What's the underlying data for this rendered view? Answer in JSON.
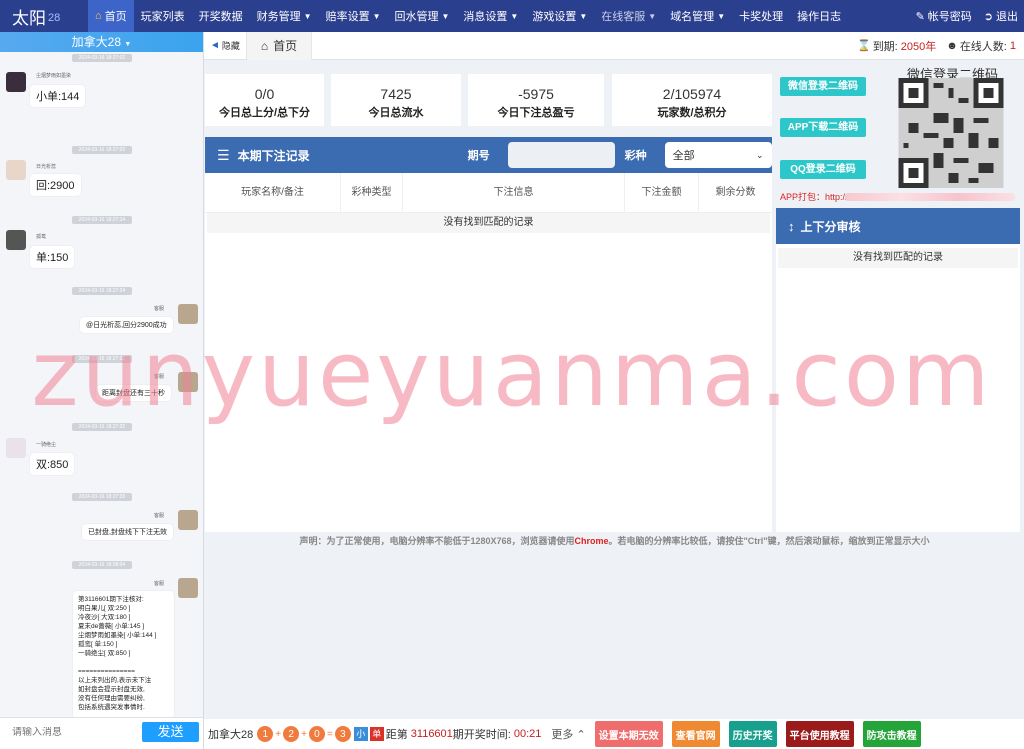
{
  "brand": {
    "name": "太阳",
    "num": "28"
  },
  "nav": {
    "items": [
      {
        "label": "首页",
        "active": true
      },
      {
        "label": "玩家列表"
      },
      {
        "label": "开奖数据"
      },
      {
        "label": "财务管理",
        "dropdown": true
      },
      {
        "label": "赔率设置",
        "dropdown": true
      },
      {
        "label": "回水管理",
        "dropdown": true
      },
      {
        "label": "消息设置",
        "dropdown": true
      },
      {
        "label": "游戏设置",
        "dropdown": true
      },
      {
        "label": "在线客服",
        "dropdown": true,
        "dim": true
      },
      {
        "label": "域名管理",
        "dropdown": true
      },
      {
        "label": "卡奖处理"
      },
      {
        "label": "操作日志"
      }
    ],
    "account_label": "帐号密码",
    "logout_label": "退出"
  },
  "chat": {
    "room": "加拿大28",
    "timestamps": [
      "2024-03-16 18:27:02",
      "2024-03-16 18:27:03",
      "2024-03-16 18:27:14",
      "2024-03-16 18:27:24",
      "2024-03-16 18:27:25",
      "2024-03-16 18:27:32",
      "2024-03-16 18:27:33",
      "2024-03-16 18:28:04"
    ],
    "messages": [
      {
        "user": "尘烟梦雨如墨染",
        "text": "小单:144"
      },
      {
        "user": "日光析蕊",
        "text": "回:2900"
      },
      {
        "user": "孤鸾",
        "text": "单:150"
      },
      {
        "user": "客服",
        "text": "@日光析蕊,回分2900成功"
      },
      {
        "user": "客服",
        "text": "距离封盘还有三十秒"
      },
      {
        "user": "一骑绝尘",
        "text": "双:850"
      },
      {
        "user": "客服",
        "text": "已封盘,封盘线下下注无效"
      },
      {
        "user": "客服",
        "text": "第3116601期下注核对:\n明白果儿[ 双:250 ]\n冷夜沙[ 大双:180 ]\n夏末de蔷薇[ 小单:145 ]\n尘烟梦雨如墨染[ 小单:144 ]\n孤鸾[ 单:150 ]\n一骑绝尘[ 双:850 ]\n\n===============\n以上未列出的,表示未下注\n如封盘会提示封盘无效,\n没有任何理由需要纠纷,\n包括系统遇突发事情时."
      }
    ],
    "input_placeholder": "请输入消息",
    "send_label": "发送"
  },
  "tabbar": {
    "hide_label": "隐藏",
    "home_tab": "首页",
    "expire_label": "到期:",
    "expire_value": "2050年",
    "online_label": "在线人数:",
    "online_value": "1"
  },
  "stats": [
    {
      "value": "0/0",
      "label": "今日总上分/总下分"
    },
    {
      "value": "7425",
      "label": "今日总流水"
    },
    {
      "value": "-5975",
      "label": "今日下注总盈亏"
    },
    {
      "value": "2/105974",
      "label": "玩家数/总积分"
    }
  ],
  "records": {
    "title": "本期下注记录",
    "period_label": "期号",
    "kind_label": "彩种",
    "kind_value": "全部",
    "columns": [
      "玩家名称/备注",
      "彩种类型",
      "下注信息",
      "下注金额",
      "剩余分数"
    ],
    "empty": "没有找到匹配的记录"
  },
  "notice": {
    "prefix": "声明：为了正常使用，电脑分辨率不能低于1280X768，浏览器请使用",
    "chrome": "Chrome",
    "suffix": "。若电脑的分辨率比较低，请按住\"Ctrl\"键，然后滚动鼠标，缩放到正常显示大小"
  },
  "right": {
    "qr_buttons": [
      "微信登录二维码",
      "APP下载二维码",
      "QQ登录二维码"
    ],
    "qr_title": "微信登录二维码",
    "apk_label": "APP打包：http://h",
    "audit_title": "上下分审核",
    "audit_empty": "没有找到匹配的记录"
  },
  "bottom": {
    "game": "加拿大28",
    "balls": [
      "1",
      "2",
      "0",
      "3"
    ],
    "ops": [
      "+",
      "+",
      "="
    ],
    "tag_small": "小",
    "tag_single": "单",
    "dist_label": "距第",
    "period": "3116601",
    "open_label": "期开奖时间:",
    "countdown": "00:21",
    "more_label": "更多",
    "buttons": [
      {
        "label": "设置本期无效",
        "color": "#f06d6d"
      },
      {
        "label": "查看官网",
        "color": "#f08a32"
      },
      {
        "label": "历史开奖",
        "color": "#17a08e"
      },
      {
        "label": "平台使用教程",
        "color": "#9b1a1a"
      },
      {
        "label": "防攻击教程",
        "color": "#25a43a"
      }
    ]
  },
  "watermark": "zunyueyuanma.com",
  "colors": {
    "nav_bg": "#2b3f8f",
    "panel_head": "#3b6bb0",
    "qr_btn": "#2ec7c9",
    "accent_red": "#c52121"
  }
}
